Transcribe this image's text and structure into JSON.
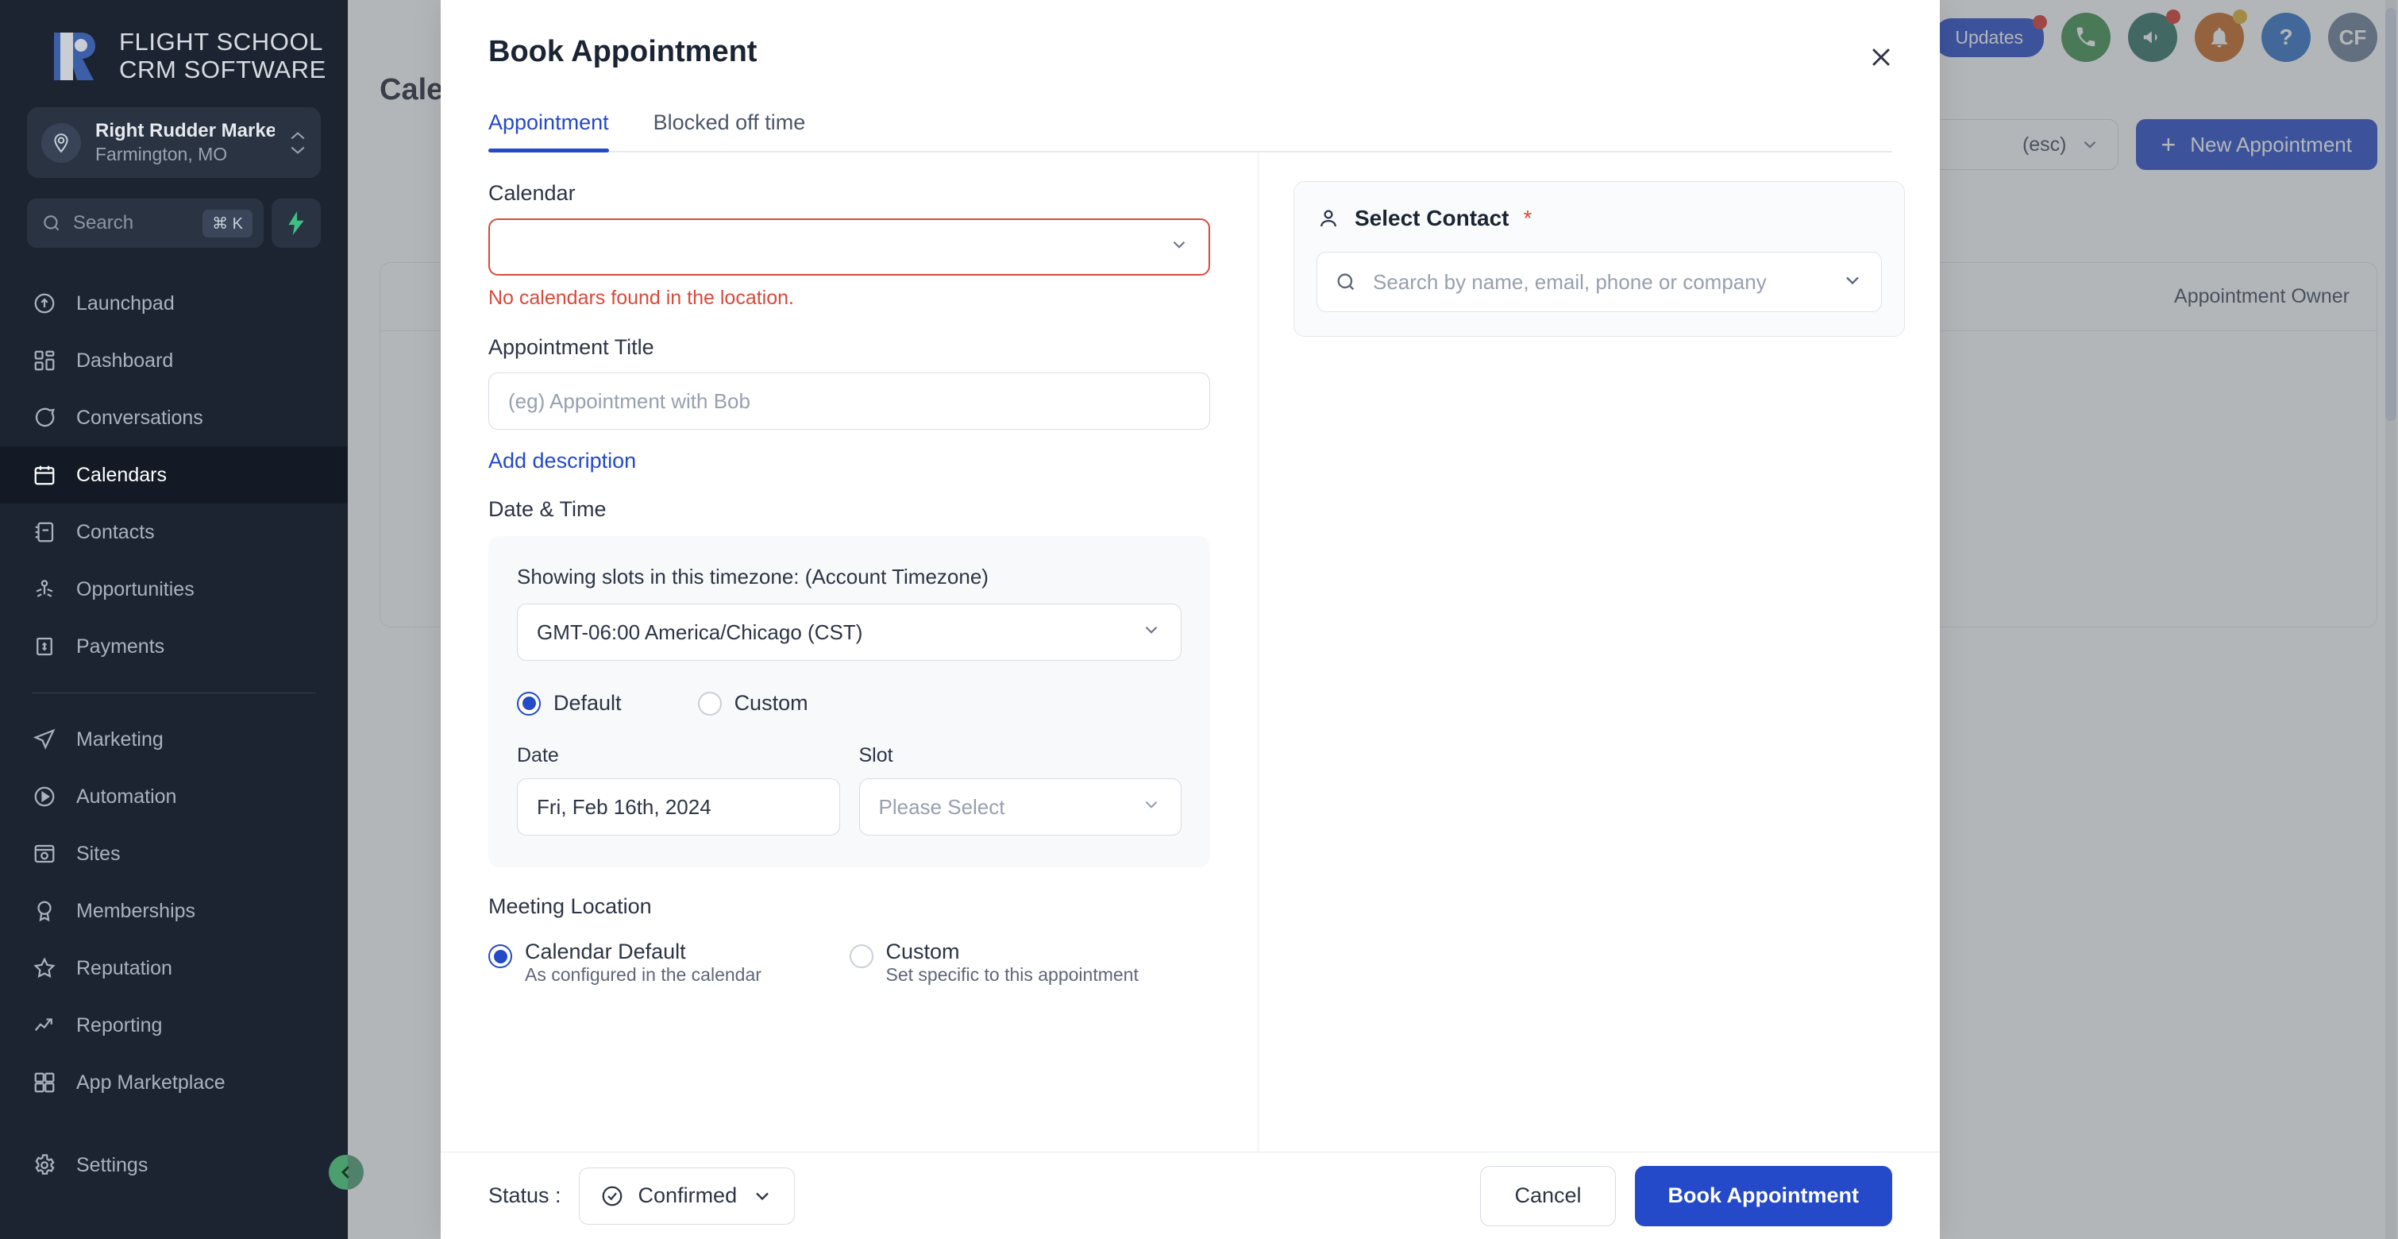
{
  "sidebar": {
    "logo": {
      "line1": "FLIGHT SCHOOL",
      "line2": "CRM SOFTWARE",
      "icon": "flight-school-logo-icon"
    },
    "location": {
      "name": "Right Rudder Market...",
      "sub": "Farmington, MO",
      "icon": "location-pin-icon"
    },
    "search": {
      "placeholder": "Search",
      "shortcut": "⌘ K",
      "icon": "search-icon",
      "bolt_icon": "bolt-icon"
    },
    "items": [
      {
        "label": "Launchpad",
        "icon": "rocket-icon",
        "active": false
      },
      {
        "label": "Dashboard",
        "icon": "dashboard-grid-icon",
        "active": false
      },
      {
        "label": "Conversations",
        "icon": "chat-bubble-icon",
        "active": false
      },
      {
        "label": "Calendars",
        "icon": "calendar-icon",
        "active": true
      },
      {
        "label": "Contacts",
        "icon": "contacts-book-icon",
        "active": false
      },
      {
        "label": "Opportunities",
        "icon": "opportunities-icon",
        "active": false
      },
      {
        "label": "Payments",
        "icon": "payments-icon",
        "active": false
      }
    ],
    "items2": [
      {
        "label": "Marketing",
        "icon": "paper-plane-icon"
      },
      {
        "label": "Automation",
        "icon": "play-circle-icon"
      },
      {
        "label": "Sites",
        "icon": "browser-globe-icon"
      },
      {
        "label": "Memberships",
        "icon": "badge-ribbon-icon"
      },
      {
        "label": "Reputation",
        "icon": "star-icon"
      },
      {
        "label": "Reporting",
        "icon": "trending-up-icon"
      },
      {
        "label": "App Marketplace",
        "icon": "apps-grid-icon"
      }
    ],
    "settings": {
      "label": "Settings",
      "icon": "gear-icon"
    },
    "collapse_icon": "chevron-left-icon"
  },
  "page": {
    "title": "Calendars",
    "updates_pill": "Updates",
    "topbar_icons": [
      {
        "name": "phone-icon",
        "color": "#3d8f4c",
        "glyph": "✆"
      },
      {
        "name": "megaphone-icon",
        "color": "#2f7060",
        "glyph": "📢"
      },
      {
        "name": "bell-icon",
        "color": "#c8641c",
        "glyph": "🔔"
      },
      {
        "name": "help-icon",
        "color": "#2d6fc4",
        "glyph": "?"
      },
      {
        "name": "avatar-initials",
        "color": "#6a7c93",
        "glyph": "CF"
      }
    ],
    "search_esc": "(esc)",
    "new_appointment": "New Appointment",
    "table_header": "Appointment Owner"
  },
  "modal": {
    "title": "Book Appointment",
    "close_icon": "close-icon",
    "tabs": [
      {
        "label": "Appointment",
        "active": true
      },
      {
        "label": "Blocked off time",
        "active": false
      }
    ],
    "calendar": {
      "label": "Calendar",
      "value": "",
      "error": "No calendars found in the location.",
      "chevron_icon": "chevron-down-icon"
    },
    "appointment_title": {
      "label": "Appointment Title",
      "placeholder": "(eg) Appointment with Bob",
      "value": ""
    },
    "add_description": "Add description",
    "date_time": {
      "label": "Date & Time",
      "timezone_note": "Showing slots in this timezone: (Account Timezone)",
      "timezone_value": "GMT-06:00 America/Chicago (CST)",
      "modes": [
        {
          "label": "Default",
          "selected": true
        },
        {
          "label": "Custom",
          "selected": false
        }
      ],
      "date_label": "Date",
      "date_value": "Fri, Feb 16th, 2024",
      "slot_label": "Slot",
      "slot_placeholder": "Please Select"
    },
    "meeting_location": {
      "label": "Meeting Location",
      "options": [
        {
          "title": "Calendar Default",
          "sub": "As configured in the calendar",
          "selected": true
        },
        {
          "title": "Custom",
          "sub": "Set specific to this appointment",
          "selected": false
        }
      ]
    },
    "contact": {
      "heading": "Select Contact",
      "required_mark": "*",
      "person_icon": "person-icon",
      "search_icon": "search-icon",
      "search_placeholder": "Search by name, email, phone or company",
      "chevron_icon": "chevron-down-icon"
    },
    "footer": {
      "status_label": "Status :",
      "status_value": "Confirmed",
      "status_icon": "check-circle-icon",
      "status_chevron": "chevron-down-icon",
      "cancel": "Cancel",
      "submit": "Book Appointment"
    }
  },
  "colors": {
    "accent": "#2449c9",
    "error": "#d84a3c",
    "sidebar_bg": "#1c2431",
    "sidebar_active": "#131a26"
  }
}
